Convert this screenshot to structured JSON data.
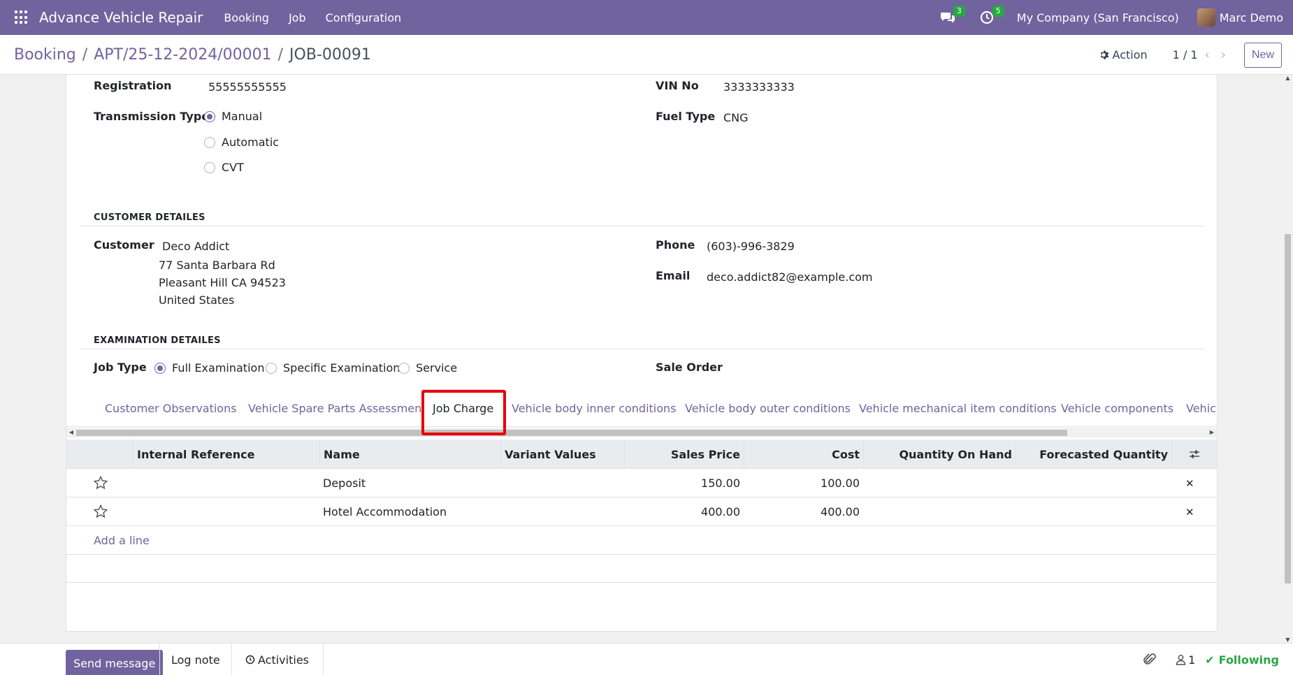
{
  "topbar": {
    "app_name": "Advance Vehicle Repair",
    "menu": [
      "Booking",
      "Job",
      "Configuration"
    ],
    "messages_count": "3",
    "activities_count": "5",
    "company": "My Company (San Francisco)",
    "user": "Marc Demo"
  },
  "breadcrumb": {
    "root": "Booking",
    "parent": "APT/25-12-2024/00001",
    "current": "JOB-00091",
    "sep": "/"
  },
  "controls": {
    "action_label": "Action",
    "pager": "1 / 1",
    "new_label": "New"
  },
  "vehicle": {
    "registration_label": "Registration",
    "registration": "55555555555",
    "vin_label": "VIN No",
    "vin": "3333333333",
    "transmission_label": "Transmission Type",
    "transmission_options": [
      "Manual",
      "Automatic",
      "CVT"
    ],
    "transmission_selected": "Manual",
    "fuel_label": "Fuel Type",
    "fuel": "CNG"
  },
  "customer": {
    "section_title": "CUSTOMER DETAILES",
    "customer_label": "Customer",
    "name": "Deco Addict",
    "street": "77 Santa Barbara Rd",
    "city": "Pleasant Hill CA 94523",
    "country": "United States",
    "phone_label": "Phone",
    "phone": "(603)-996-3829",
    "email_label": "Email",
    "email": "deco.addict82@example.com"
  },
  "examination": {
    "section_title": "EXAMINATION DETAILES",
    "job_type_label": "Job Type",
    "job_type_options": [
      "Full Examination",
      "Specific Examination",
      "Service"
    ],
    "job_type_selected": "Full Examination",
    "sale_order_label": "Sale Order"
  },
  "tabs": [
    "Customer Observations",
    "Vehicle Spare Parts Assessment",
    "Job Charge",
    "Vehicle body inner conditions",
    "Vehicle body outer conditions",
    "Vehicle mechanical item conditions",
    "Vehicle components",
    "Vehicl"
  ],
  "active_tab": "Job Charge",
  "grid": {
    "columns": [
      "Internal Reference",
      "Name",
      "Variant Values",
      "Sales Price",
      "Cost",
      "Quantity On Hand",
      "Forecasted Quantity"
    ],
    "rows": [
      {
        "internal_reference": "",
        "name": "Deposit",
        "variant_values": "",
        "sales_price": "150.00",
        "cost": "100.00",
        "qty_on_hand": "",
        "forecasted": ""
      },
      {
        "internal_reference": "",
        "name": "Hotel Accommodation",
        "variant_values": "",
        "sales_price": "400.00",
        "cost": "400.00",
        "qty_on_hand": "",
        "forecasted": ""
      }
    ],
    "add_line": "Add a line"
  },
  "chatter": {
    "send_message": "Send message",
    "log_note": "Log note",
    "activities": "Activities",
    "followers_count": "1",
    "following": "Following"
  },
  "colors": {
    "brand": "#71639e",
    "badge": "#28a745",
    "highlight": "#e8000b"
  }
}
